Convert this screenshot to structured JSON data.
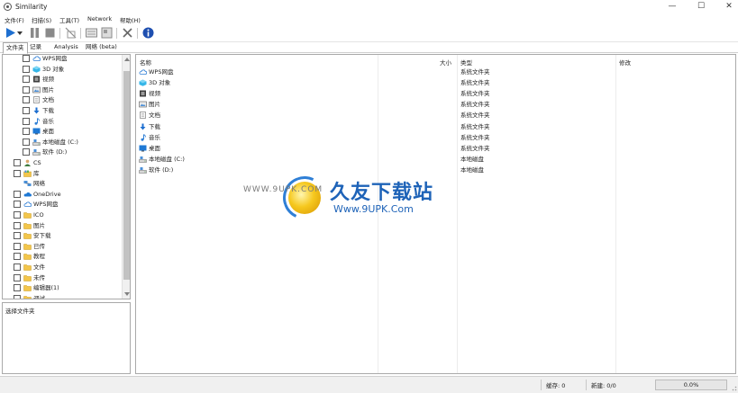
{
  "window": {
    "title": "Similarity"
  },
  "menu": [
    {
      "label": "文件(F)"
    },
    {
      "label": "扫描(S)"
    },
    {
      "label": "工具(T)"
    },
    {
      "label": "Network"
    },
    {
      "label": "帮助(H)"
    }
  ],
  "toolbar": {
    "buttons": [
      "play-icon",
      "dropdown-arrow-icon",
      "pause-icon",
      "stop-icon",
      "clear-icon",
      "results-icon",
      "export-icon",
      "tools-icon",
      "info-icon"
    ]
  },
  "tabs": [
    {
      "label": "文件夹"
    },
    {
      "label": "记录"
    },
    {
      "label": "Analysis"
    },
    {
      "label": "网络 (beta)"
    }
  ],
  "tree": {
    "items": [
      {
        "label": "WPS网盘",
        "icon": "cloud-icon",
        "checkbox": true
      },
      {
        "label": "3D 对象",
        "icon": "3d-objects-icon",
        "checkbox": true
      },
      {
        "label": "视频",
        "icon": "video-icon",
        "checkbox": true
      },
      {
        "label": "图片",
        "icon": "pictures-icon",
        "checkbox": true
      },
      {
        "label": "文档",
        "icon": "documents-icon",
        "checkbox": true
      },
      {
        "label": "下载",
        "icon": "download-icon",
        "checkbox": true
      },
      {
        "label": "音乐",
        "icon": "music-icon",
        "checkbox": true
      },
      {
        "label": "桌面",
        "icon": "desktop-icon",
        "checkbox": true
      },
      {
        "label": "本地磁盘 (C:)",
        "icon": "drive-icon",
        "checkbox": true
      },
      {
        "label": "软件 (D:)",
        "icon": "drive-icon",
        "checkbox": true
      },
      {
        "label": "CS",
        "icon": "user-icon",
        "checkbox": true
      },
      {
        "label": "库",
        "icon": "library-icon",
        "checkbox": true
      },
      {
        "label": "网络",
        "icon": "network-icon",
        "checkbox": false
      },
      {
        "label": "OneDrive",
        "icon": "onedrive-icon",
        "checkbox": true
      },
      {
        "label": "WPS网盘",
        "icon": "cloud-icon",
        "checkbox": true
      },
      {
        "label": "ICO",
        "icon": "folder-icon",
        "checkbox": true
      },
      {
        "label": "图片",
        "icon": "folder-icon",
        "checkbox": true
      },
      {
        "label": "安下载",
        "icon": "folder-icon",
        "checkbox": true
      },
      {
        "label": "已传",
        "icon": "folder-icon",
        "checkbox": true
      },
      {
        "label": "教程",
        "icon": "folder-icon",
        "checkbox": true
      },
      {
        "label": "文件",
        "icon": "folder-icon",
        "checkbox": true
      },
      {
        "label": "未传",
        "icon": "folder-icon",
        "checkbox": true
      },
      {
        "label": "编辑器(1)",
        "icon": "folder-icon",
        "checkbox": true
      },
      {
        "label": "调试",
        "icon": "folder-icon",
        "checkbox": true
      }
    ]
  },
  "info_panel": {
    "label": "选择文件夹"
  },
  "list": {
    "columns": {
      "name": "名称",
      "size": "大小",
      "type": "类型",
      "modified": "修改"
    },
    "rows": [
      {
        "name": "WPS网盘",
        "type": "系统文件夹",
        "icon": "cloud-icon"
      },
      {
        "name": "3D 对象",
        "type": "系统文件夹",
        "icon": "3d-objects-icon"
      },
      {
        "name": "视频",
        "type": "系统文件夹",
        "icon": "video-icon"
      },
      {
        "name": "图片",
        "type": "系统文件夹",
        "icon": "pictures-icon"
      },
      {
        "name": "文档",
        "type": "系统文件夹",
        "icon": "documents-icon"
      },
      {
        "name": "下载",
        "type": "系统文件夹",
        "icon": "download-icon"
      },
      {
        "name": "音乐",
        "type": "系统文件夹",
        "icon": "music-icon"
      },
      {
        "name": "桌面",
        "type": "系统文件夹",
        "icon": "desktop-icon"
      },
      {
        "name": "本地磁盘 (C:)",
        "type": "本地磁盘",
        "icon": "drive-icon"
      },
      {
        "name": "软件 (D:)",
        "type": "本地磁盘",
        "icon": "drive-icon"
      }
    ]
  },
  "watermark": {
    "domain_top": "WWW.9UPK.COM",
    "brand": "久友下载站",
    "domain": "Www.9UPK.Com"
  },
  "status": {
    "cache_label": "缓存: 0",
    "new_label": "新建: 0/0",
    "progress_text": "0.0%",
    "progress_value": 0
  },
  "colors": {
    "accent": "#1e63b8",
    "progress": "#06b025",
    "folder": "#f3c64b"
  }
}
